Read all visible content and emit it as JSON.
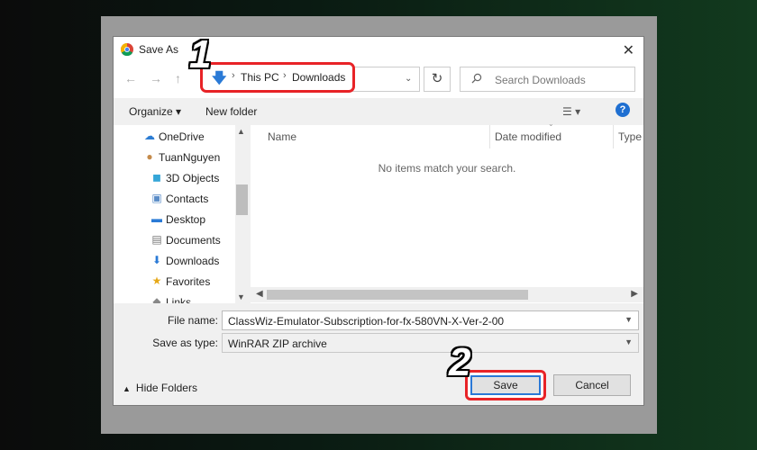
{
  "window": {
    "title": "Save As",
    "close_glyph": "✕",
    "app_icon": "chrome-icon"
  },
  "nav": {
    "back": "←",
    "forward": "→",
    "up": "↑",
    "refresh_glyph": "↻",
    "dropdown_glyph": "⌄"
  },
  "breadcrumb": {
    "items": [
      "This PC",
      "Downloads"
    ],
    "separator": "›",
    "location_icon": "download-arrow-icon"
  },
  "search": {
    "placeholder": "Search Downloads",
    "icon": "search-icon"
  },
  "toolbar": {
    "organize": "Organize ▾",
    "new_folder": "New folder",
    "view_glyph": "☰ ▾",
    "help": "?"
  },
  "sidebar": {
    "items": [
      {
        "label": "OneDrive",
        "icon": "cloud-icon",
        "glyph": "☁",
        "color": "#2b7cd3"
      },
      {
        "label": "TuanNguyen",
        "icon": "user-icon",
        "glyph": "👤",
        "color": "#c58b4b"
      },
      {
        "label": "3D Objects",
        "icon": "cube-icon",
        "glyph": "◼",
        "color": "#35a6d8"
      },
      {
        "label": "Contacts",
        "icon": "contacts-icon",
        "glyph": "▣",
        "color": "#5a8cc7"
      },
      {
        "label": "Desktop",
        "icon": "desktop-icon",
        "glyph": "▬",
        "color": "#2a7ad6"
      },
      {
        "label": "Documents",
        "icon": "document-icon",
        "glyph": "▤",
        "color": "#777"
      },
      {
        "label": "Downloads",
        "icon": "download-icon",
        "glyph": "⬇",
        "color": "#2a7ad6"
      },
      {
        "label": "Favorites",
        "icon": "star-folder-icon",
        "glyph": "★",
        "color": "#e6a817"
      },
      {
        "label": "Links",
        "icon": "link-icon",
        "glyph": "⛓",
        "color": "#888"
      }
    ]
  },
  "files": {
    "columns": [
      "Name",
      "Date modified",
      "Type"
    ],
    "empty_message": "No items match your search."
  },
  "form": {
    "file_name_label": "File name:",
    "file_name_value": "ClassWiz-Emulator-Subscription-for-fx-580VN-X-Ver-2-00",
    "save_type_label": "Save as type:",
    "save_type_value": "WinRAR ZIP archive"
  },
  "footer": {
    "hide_folders": "Hide Folders",
    "save": "Save",
    "cancel": "Cancel"
  },
  "annotations": {
    "step1": "1",
    "step2": "2",
    "highlight_color": "#e82327"
  }
}
